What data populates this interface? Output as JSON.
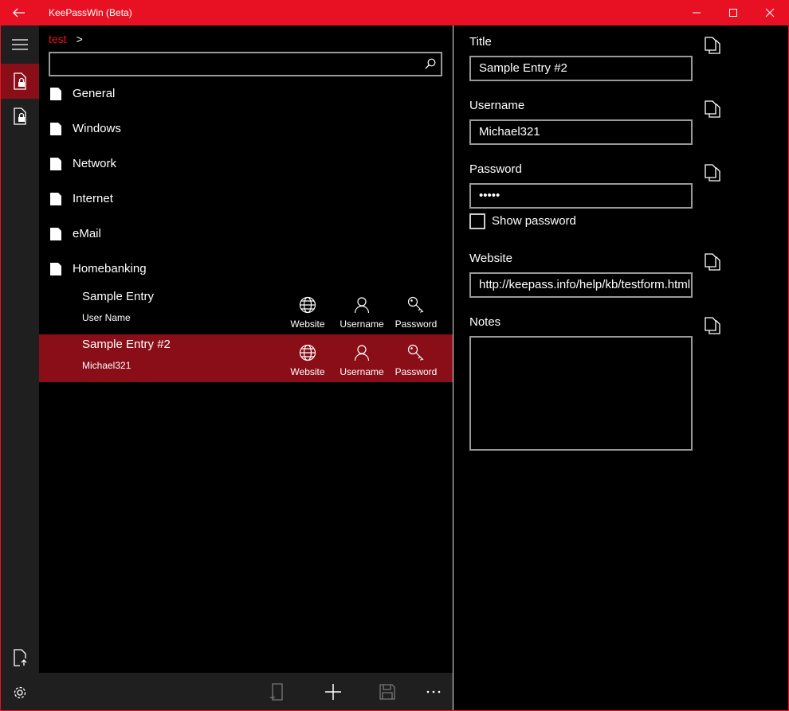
{
  "window": {
    "title": "KeePassWin (Beta)"
  },
  "breadcrumb": {
    "crumb": "test",
    "separator": ">"
  },
  "search": {
    "placeholder": "",
    "value": ""
  },
  "groups": [
    {
      "label": "General"
    },
    {
      "label": "Windows"
    },
    {
      "label": "Network"
    },
    {
      "label": "Internet"
    },
    {
      "label": "eMail"
    },
    {
      "label": "Homebanking"
    }
  ],
  "entries": [
    {
      "title": "Sample Entry",
      "subtitle": "User Name",
      "selected": false,
      "actions": {
        "website": "Website",
        "username": "Username",
        "password": "Password"
      }
    },
    {
      "title": "Sample Entry #2",
      "subtitle": "Michael321",
      "selected": true,
      "actions": {
        "website": "Website",
        "username": "Username",
        "password": "Password"
      }
    }
  ],
  "detail": {
    "title_label": "Title",
    "title_value": "Sample Entry #2",
    "username_label": "Username",
    "username_value": "Michael321",
    "password_label": "Password",
    "password_value": "•••••",
    "show_password_label": "Show password",
    "website_label": "Website",
    "website_value": "http://keepass.info/help/kb/testform.html",
    "notes_label": "Notes",
    "notes_value": ""
  },
  "icons": {
    "back": "back-arrow-icon",
    "menu": "hamburger-icon",
    "db1": "locked-database-icon",
    "db2": "locked-database-icon",
    "open": "open-file-icon",
    "settings": "gear-icon",
    "group": "folder-icon",
    "website": "globe-icon",
    "username": "person-icon",
    "password": "key-icon",
    "copy": "copy-icon",
    "new": "new-entry-icon",
    "add": "plus-icon",
    "save": "save-icon",
    "more": "more-icon"
  },
  "colors": {
    "accent": "#e81123",
    "selected": "#8a0e17",
    "rail": "#1f1f1f",
    "background": "#000000"
  }
}
